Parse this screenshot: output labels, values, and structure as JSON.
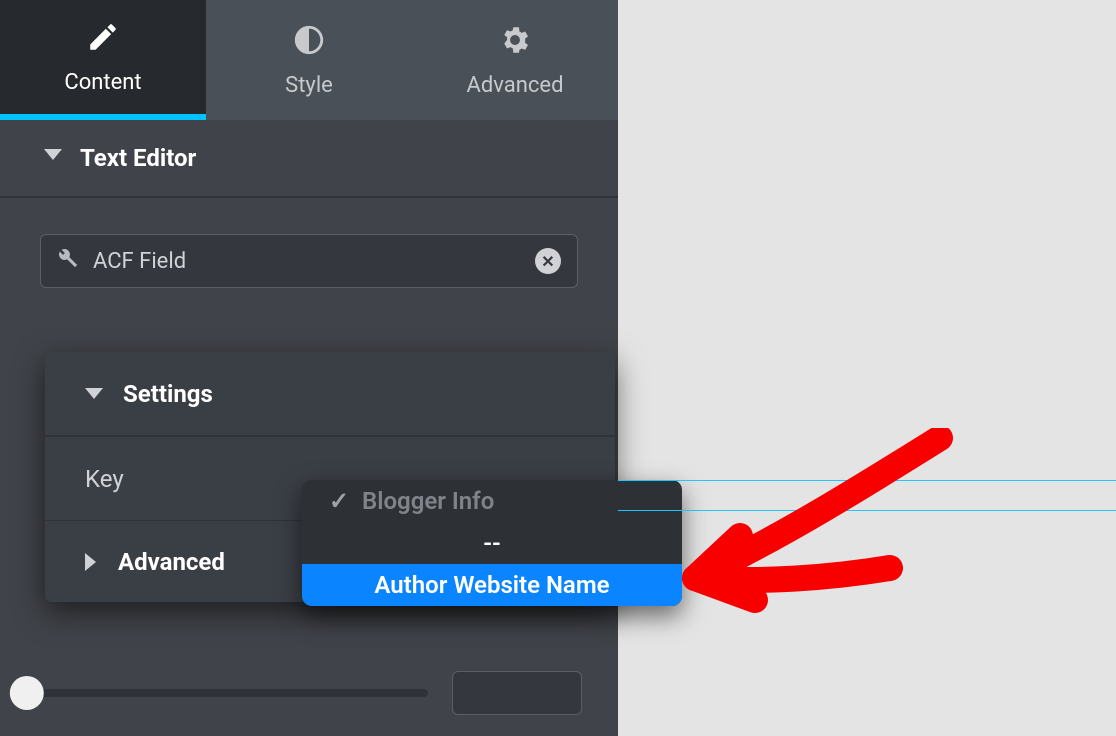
{
  "tabs": {
    "content": "Content",
    "style": "Style",
    "advanced": "Advanced"
  },
  "section": {
    "title": "Text Editor"
  },
  "dynamic_tag": {
    "label": "ACF Field"
  },
  "settings": {
    "title": "Settings",
    "key_label": "Key",
    "advanced_title": "Advanced"
  },
  "dropdown": {
    "group": "Blogger Info",
    "dash": "--",
    "selected": "Author Website Name"
  }
}
